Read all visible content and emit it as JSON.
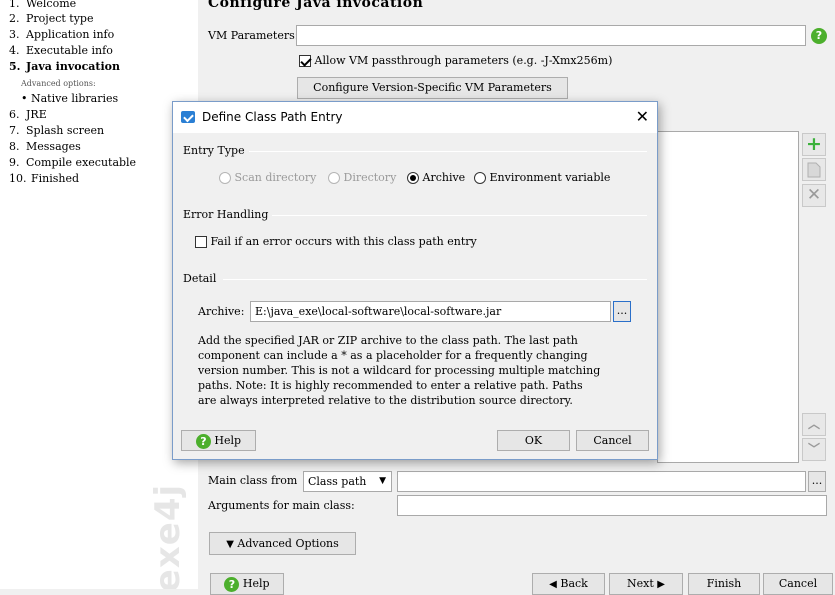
{
  "steps": [
    {
      "num": "1.",
      "label": "Welcome"
    },
    {
      "num": "2.",
      "label": "Project type"
    },
    {
      "num": "3.",
      "label": "Application info"
    },
    {
      "num": "4.",
      "label": "Executable info"
    },
    {
      "num": "5.",
      "label": "Java invocation"
    },
    {
      "num": "",
      "label": "Advanced options:"
    },
    {
      "num": "•",
      "label": "Native libraries"
    },
    {
      "num": "6.",
      "label": "JRE"
    },
    {
      "num": "7.",
      "label": "Splash screen"
    },
    {
      "num": "8.",
      "label": "Messages"
    },
    {
      "num": "9.",
      "label": "Compile executable"
    },
    {
      "num": "10.",
      "label": "Finished"
    }
  ],
  "brand": "exe4j",
  "main": {
    "title": "Configure Java invocation",
    "vm_parameters_label": "VM Parameters:",
    "vm_parameters_value": "",
    "allow_passthrough_label": "Allow VM passthrough parameters (e.g. -J-Xmx256m)",
    "allow_passthrough_checked": true,
    "version_specific_button": "Configure Version-Specific VM Parameters",
    "main_class_label": "Main class from",
    "main_class_source": "Class path",
    "main_class_value": "",
    "arguments_label": "Arguments for main class:",
    "arguments_value": "",
    "advanced_options_button": "Advanced Options",
    "ellipsis": "..."
  },
  "footer": {
    "help": "Help",
    "back": "Back",
    "next": "Next",
    "finish": "Finish",
    "cancel": "Cancel"
  },
  "dialog": {
    "title": "Define Class Path Entry",
    "entry_type_label": "Entry Type",
    "entry_types": [
      {
        "label": "Scan directory",
        "selected": false,
        "enabled": false
      },
      {
        "label": "Directory",
        "selected": false,
        "enabled": false
      },
      {
        "label": "Archive",
        "selected": true,
        "enabled": true
      },
      {
        "label": "Environment variable",
        "selected": false,
        "enabled": true
      }
    ],
    "error_handling_label": "Error Handling",
    "fail_on_error_label": "Fail if an error occurs with this class path entry",
    "fail_on_error_checked": false,
    "detail_label": "Detail",
    "archive_label": "Archive:",
    "archive_value": "E:\\java_exe\\local-software\\local-software.jar",
    "browse_label": "...",
    "description": "Add the specified JAR or ZIP archive to the class path. The last path\ncomponent can include a * as a placeholder for a frequently changing\nversion number. This is not a wildcard for processing multiple matching\npaths. Note: It is highly recommended to enter a relative path. Paths\nare always interpreted relative to the distribution source directory.",
    "help_button": "Help",
    "ok_button": "OK",
    "cancel_button": "Cancel"
  }
}
